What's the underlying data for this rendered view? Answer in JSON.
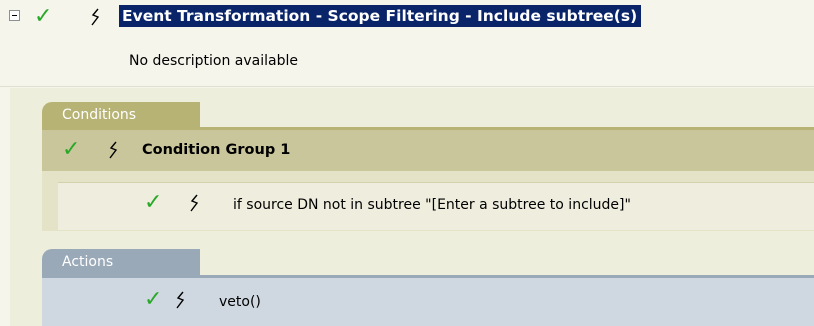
{
  "rule": {
    "title": "Event Transformation - Scope Filtering - Include subtree(s)",
    "description": "No description available"
  },
  "conditions": {
    "tab_label": "Conditions",
    "group_label": "Condition Group 1",
    "items": [
      {
        "text": "if source DN not in subtree \"[Enter a subtree to include]\""
      }
    ]
  },
  "actions": {
    "tab_label": "Actions",
    "items": [
      {
        "text": "veto()"
      }
    ]
  },
  "icons": {
    "collapse": "collapse-minus-icon",
    "enabled": "check-icon",
    "trace": "lightning-icon"
  },
  "colors": {
    "check": "#2aa82a",
    "title_highlight": "#0a246a",
    "conditions_tab": "#b7b374",
    "actions_tab": "#9aa9b8"
  }
}
